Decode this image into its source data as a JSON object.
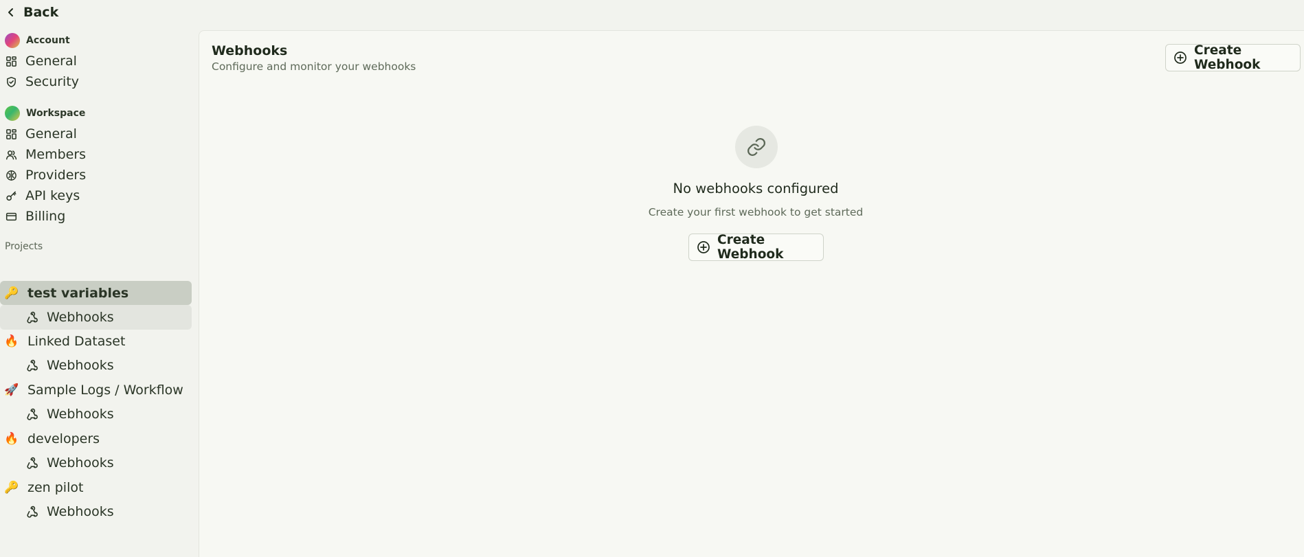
{
  "back": {
    "label": "Back"
  },
  "sidebar": {
    "account": {
      "label": "Account",
      "items": [
        {
          "label": "General",
          "icon": "grid-icon"
        },
        {
          "label": "Security",
          "icon": "shield-icon"
        }
      ]
    },
    "workspace": {
      "label": "Workspace",
      "items": [
        {
          "label": "General",
          "icon": "grid-icon"
        },
        {
          "label": "Members",
          "icon": "users-icon"
        },
        {
          "label": "Providers",
          "icon": "brain-icon"
        },
        {
          "label": "API keys",
          "icon": "key-icon"
        },
        {
          "label": "Billing",
          "icon": "credit-card-icon"
        }
      ]
    },
    "projects": {
      "label": "Projects",
      "items": [
        {
          "emoji": "🔑",
          "label": "test variables",
          "sub_label": "Webhooks",
          "selected": true
        },
        {
          "emoji": "🔥",
          "label": "Linked Dataset",
          "sub_label": "Webhooks"
        },
        {
          "emoji": "🚀",
          "label": "Sample Logs / Workflow",
          "sub_label": "Webhooks"
        },
        {
          "emoji": "🔥",
          "label": "developers",
          "sub_label": "Webhooks"
        },
        {
          "emoji": "🔑",
          "label": "zen pilot",
          "sub_label": "Webhooks"
        }
      ]
    }
  },
  "main": {
    "title": "Webhooks",
    "subtitle": "Configure and monitor your webhooks",
    "create_button_label": "Create Webhook",
    "empty_state": {
      "icon": "link-icon",
      "title": "No webhooks configured",
      "text": "Create your first webhook to get started",
      "button_label": "Create Webhook"
    }
  },
  "colors": {
    "background": "#f2f3ee",
    "panel": "#f7f8f3",
    "selected_project": "#c9cec4",
    "selected_sub": "#e3e5df",
    "text": "#1f2a1c",
    "muted_text": "#5e6a59"
  }
}
